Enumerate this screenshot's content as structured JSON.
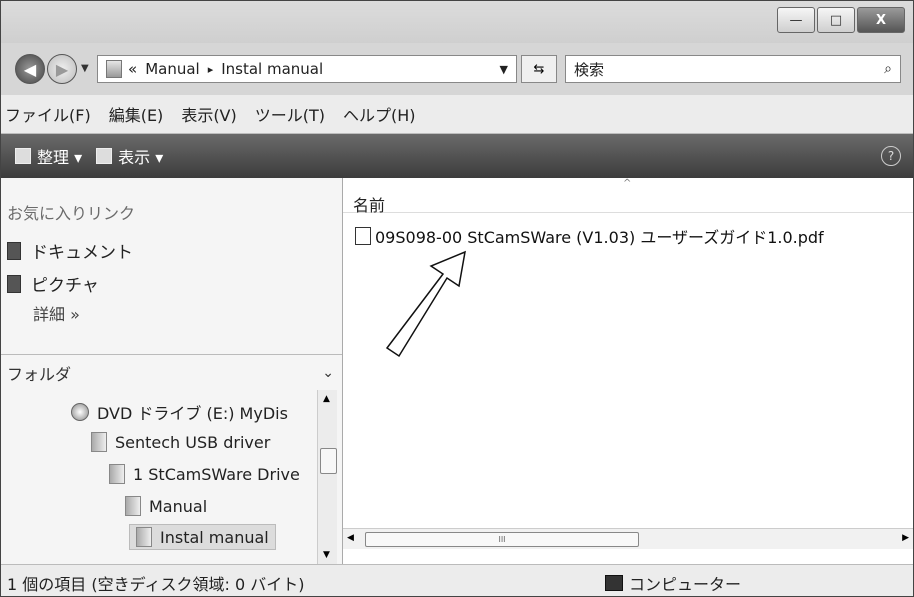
{
  "window": {
    "controls": {
      "minimize": "—",
      "maximize": "□",
      "close": "X"
    }
  },
  "nav": {
    "back_icon": "left-arrow-icon",
    "forward_icon": "right-arrow-icon",
    "address": {
      "prefix": "«",
      "part1": "Manual",
      "separator": "▸",
      "part2": "Instal manual"
    },
    "search_placeholder": "検索",
    "search_icon": "magnifier-icon"
  },
  "menubar": [
    "ファイル(F)",
    "編集(E)",
    "表示(V)",
    "ツール(T)",
    "ヘルプ(H)"
  ],
  "toolbar": {
    "organize": "整理 ▾",
    "view": "表示 ▾",
    "help": "?"
  },
  "sidebar": {
    "favorites_title": "お気に入りリンク",
    "favorites": [
      "ドキュメント",
      "ピクチャ"
    ],
    "more": "詳細 »",
    "folders_title": "フォルダ",
    "tree": [
      {
        "label": "DVD ドライブ (E:) MyDis",
        "type": "dvd"
      },
      {
        "label": "Sentech USB driver",
        "type": "folder"
      },
      {
        "label": "1 StCamSWare Drive",
        "type": "folder"
      },
      {
        "label": "Manual",
        "type": "folder"
      },
      {
        "label": "Instal manual",
        "type": "folder",
        "selected": true
      }
    ]
  },
  "content": {
    "column_name": "名前",
    "sort_indicator": "^",
    "files": [
      "09S098-00 StCamSWare (V1.03) ユーザーズガイド1.0.pdf"
    ],
    "hscroll_mark": "III"
  },
  "status": {
    "left": "1 個の項目 (空きディスク領域: 0 バイト)",
    "right": "コンピューター"
  },
  "colors": {
    "toolbar": "#4a4a4a",
    "background": "#ececec",
    "content": "#ffffff"
  }
}
